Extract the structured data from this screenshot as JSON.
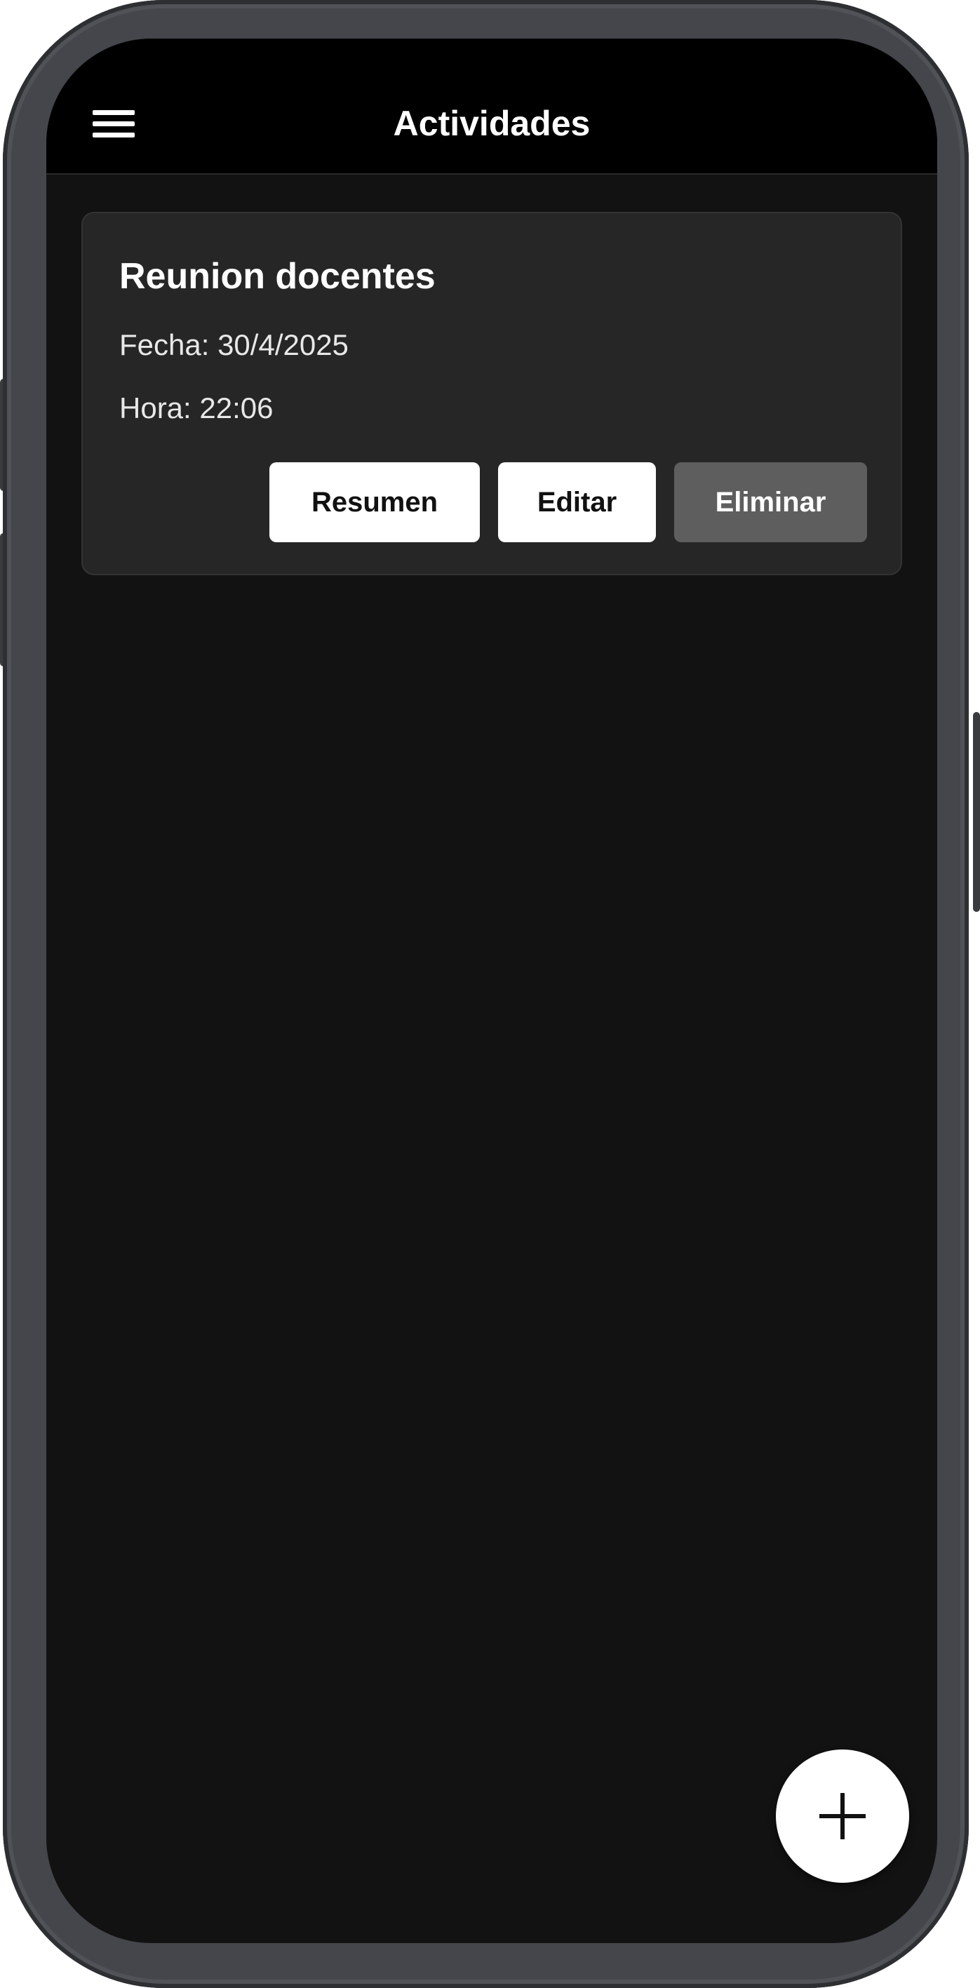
{
  "app_bar": {
    "title": "Actividades",
    "menu_icon": "hamburger-menu-icon"
  },
  "activities": [
    {
      "title": "Reunion docentes",
      "date_text": "Fecha: 30/4/2025",
      "time_text": "Hora: 22:06",
      "actions": {
        "summary_label": "Resumen",
        "edit_label": "Editar",
        "delete_label": "Eliminar"
      }
    }
  ],
  "fab": {
    "icon": "plus-icon"
  },
  "colors": {
    "screen_background": "#121212",
    "app_bar_background": "#000000",
    "card_background": "#262626",
    "light_button": "#ffffff",
    "delete_button": "#5e5e5e",
    "phone_frame": "#44464b"
  }
}
